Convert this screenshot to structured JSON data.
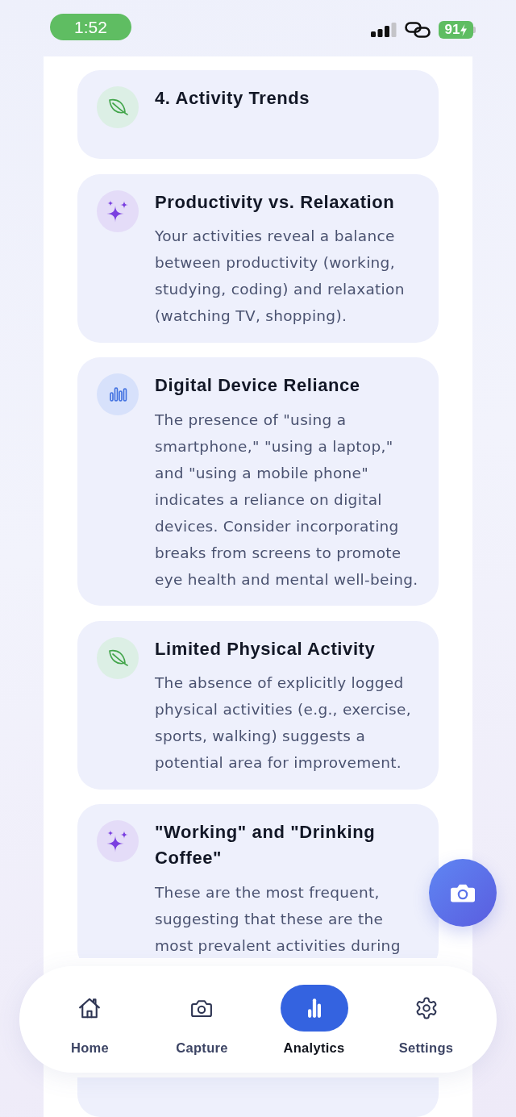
{
  "status_bar": {
    "time": "1:52",
    "battery": "91"
  },
  "cards": [
    {
      "kind": "leaf",
      "title": "4. Activity Trends"
    },
    {
      "kind": "sparkle",
      "title": "Productivity vs. Relaxation",
      "text": "Your activities reveal a balance between productivity (working, studying, coding) and relaxation (watching TV, shopping)."
    },
    {
      "kind": "chart",
      "title": "Digital Device Reliance",
      "text": "The presence of \"using a smartphone,\" \"using a laptop,\" and \"using a mobile phone\" indicates a reliance on digital devices. Consider incorporating breaks from screens to promote eye health and mental well-being."
    },
    {
      "kind": "leaf",
      "title": "Limited Physical Activity",
      "text": "The absence of explicitly logged physical activities (e.g., exercise, sports, walking) suggests a potential area for improvement."
    },
    {
      "kind": "sparkle",
      "title": "\"Working\" and \"Drinking Coffee\"",
      "text": "These are the most frequent, suggesting that these are the most prevalent activities during"
    }
  ],
  "tabs": [
    {
      "kind": "home",
      "label": "Home",
      "selected": false
    },
    {
      "kind": "camera",
      "label": "Capture",
      "selected": false
    },
    {
      "kind": "chart",
      "label": "Analytics",
      "selected": true
    },
    {
      "kind": "gear",
      "label": "Settings",
      "selected": false
    }
  ]
}
